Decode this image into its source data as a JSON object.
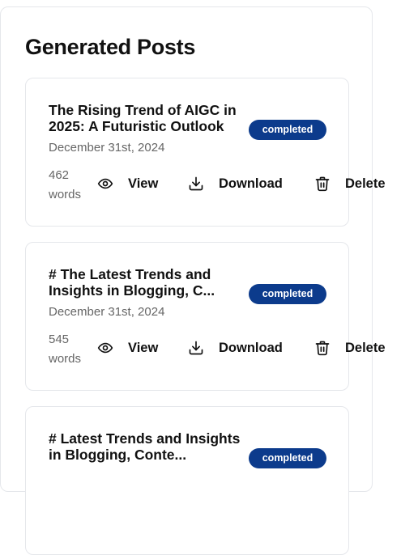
{
  "page": {
    "title": "Generated Posts"
  },
  "posts": [
    {
      "title": "The Rising Trend of AIGC in 2025: A Futuristic Outlook",
      "status": "completed",
      "date": "December 31st, 2024",
      "word_count": "462",
      "word_unit": "words"
    },
    {
      "title": "# The Latest Trends and Insights in Blogging, C...",
      "status": "completed",
      "date": "December 31st, 2024",
      "word_count": "545",
      "word_unit": "words"
    },
    {
      "title": "# Latest Trends and Insights in Blogging, Conte...",
      "status": "completed"
    }
  ],
  "actions": {
    "view_label": "View",
    "download_label": "Download",
    "delete_label": "Delete"
  },
  "colors": {
    "badge_bg": "#0c3b8c",
    "text_primary": "#111111",
    "text_muted": "#666666",
    "border": "#e5e7eb"
  },
  "icons": {
    "view": "eye-icon",
    "download": "download-icon",
    "delete": "trash-icon"
  }
}
